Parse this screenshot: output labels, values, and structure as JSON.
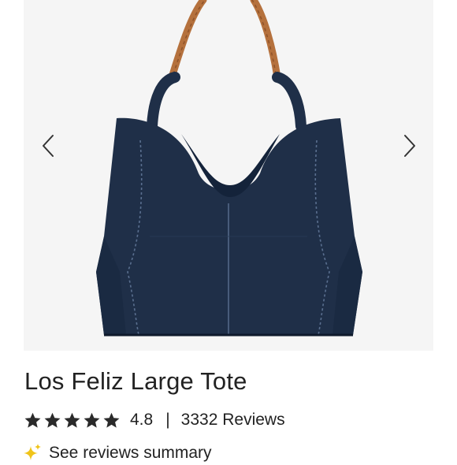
{
  "product": {
    "title": "Los Feliz Large Tote",
    "rating_value": "4.8",
    "rating_stars": 5,
    "separator": "|",
    "reviews_text": "3332 Reviews",
    "see_summary": "See reviews summary"
  },
  "icons": {
    "prev": "chevron-left-icon",
    "next": "chevron-right-icon",
    "star": "star-icon",
    "sparkle": "sparkle-icon"
  },
  "colors": {
    "bag": "#1f2f48",
    "strap": "#b5713d",
    "star": "#2a2a2a",
    "sparkle": "#f0c419"
  }
}
